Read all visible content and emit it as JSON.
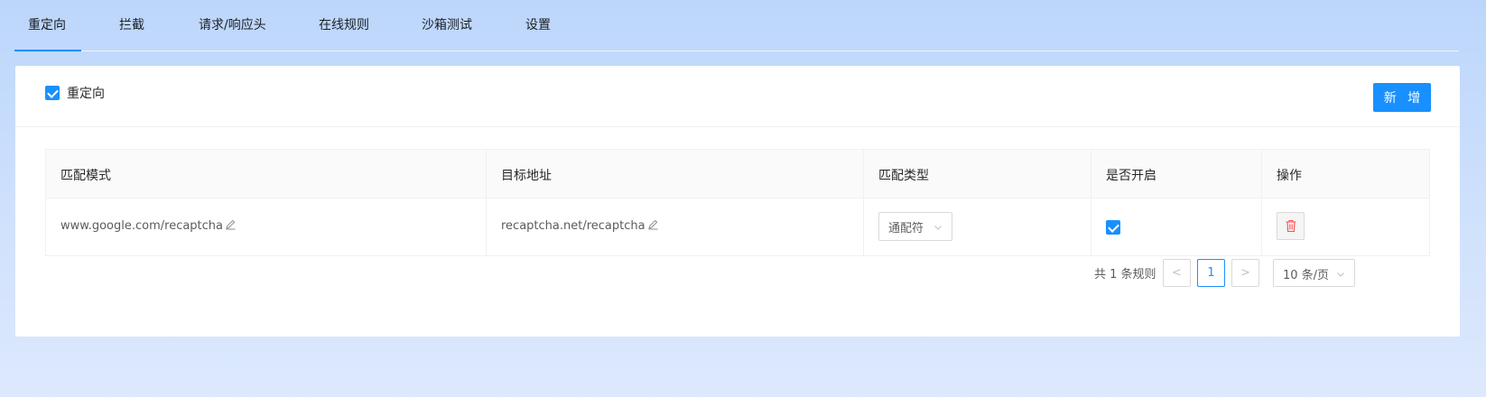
{
  "tabs": [
    {
      "label": "重定向",
      "active": true
    },
    {
      "label": "拦截"
    },
    {
      "label": "请求/响应头"
    },
    {
      "label": "在线规则"
    },
    {
      "label": "沙箱测试"
    },
    {
      "label": "设置"
    }
  ],
  "header": {
    "toggle_label": "重定向",
    "toggle_checked": true,
    "add_button_label": "新 增"
  },
  "table": {
    "columns": [
      "匹配模式",
      "目标地址",
      "匹配类型",
      "是否开启",
      "操作"
    ],
    "rows": [
      {
        "pattern": "www.google.com/recaptcha",
        "target": "recaptcha.net/recaptcha",
        "match_type": "通配符",
        "enabled": true
      }
    ]
  },
  "pagination": {
    "total_text": "共 1 条规则",
    "current_page": "1",
    "prev_symbol": "<",
    "next_symbol": ">",
    "page_size": "10 条/页"
  },
  "colors": {
    "primary": "#1890ff",
    "danger": "#ff4d4f"
  },
  "icons": [
    "check-icon",
    "edit-icon",
    "chevron-down-icon",
    "delete-icon"
  ]
}
